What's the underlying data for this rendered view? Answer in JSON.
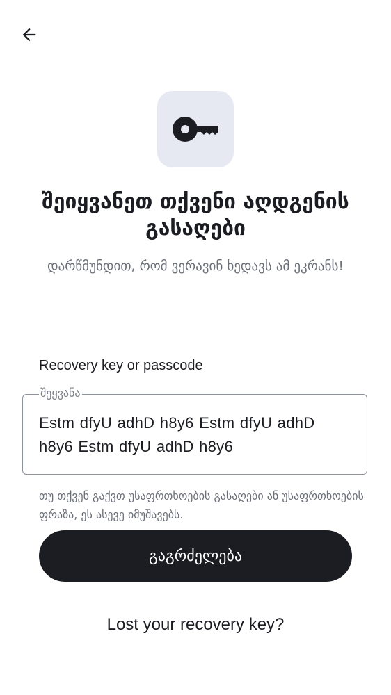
{
  "header": {
    "back_icon": "arrow-left-icon"
  },
  "hero": {
    "icon": "key-icon",
    "title": "შეიყვანეთ თქვენი აღდგენის გასაღები",
    "subtitle": "დარწმუნდით, რომ ვერავინ ხედავს ამ ეკრანს!"
  },
  "form": {
    "label": "Recovery key or passcode",
    "legend": "შეყვანა",
    "value": "Estm dfyU adhD h8y6 Estm dfyU adhD h8y6 Estm dfyU adhD h8y6",
    "helper": "თუ თქვენ გაქვთ უსაფრთხოების გასაღები ან უსაფრთხოების ფრაზა, ეს ასევე იმუშავებს."
  },
  "actions": {
    "continue_label": "გაგრძელება",
    "lost_key_label": "Lost your recovery key?"
  },
  "colors": {
    "primary": "#1b1d22",
    "icon_tile": "#e6e9f2",
    "muted_text": "#6b6f78"
  }
}
